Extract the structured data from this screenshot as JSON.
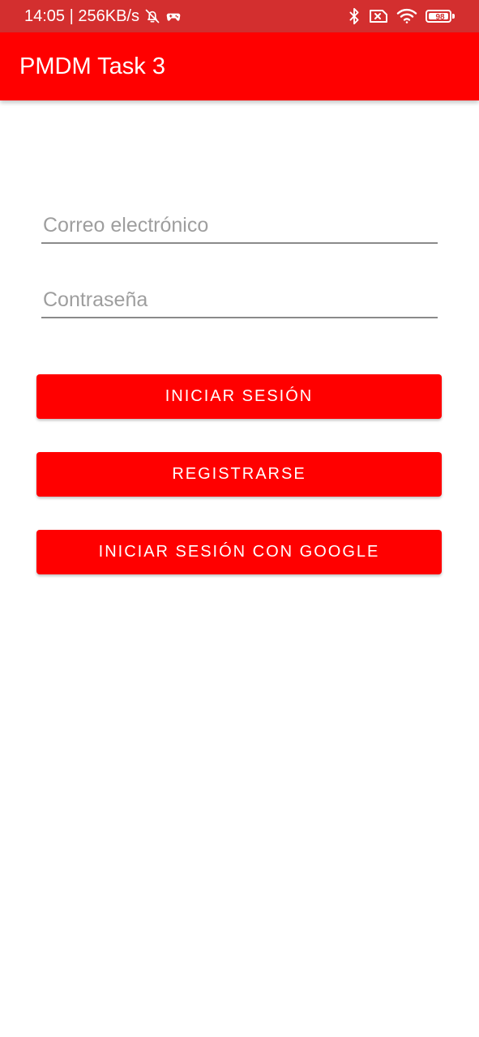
{
  "status_bar": {
    "time_network": "14:05 | 256KB/s",
    "battery_level": "98",
    "icons": [
      "bell-off-icon",
      "game-controller-icon",
      "bluetooth-icon",
      "sim-blocked-icon",
      "wifi-icon",
      "battery-icon"
    ],
    "color": "#d32f2f"
  },
  "app_bar": {
    "title": "PMDM Task 3",
    "color": "#ff0000"
  },
  "form": {
    "email_placeholder": "Correo electrónico",
    "password_placeholder": "Contraseña",
    "login_label": "INICIAR SESIÓN",
    "register_label": "REGISTRARSE",
    "google_label": "INICIAR SESIÓN CON GOOGLE",
    "button_color": "#ff0000"
  }
}
